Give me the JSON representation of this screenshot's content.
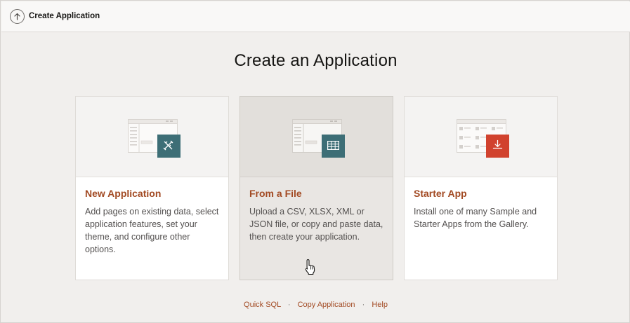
{
  "header": {
    "title": "Create Application",
    "back_icon": "arrow-up-circle-icon"
  },
  "main": {
    "heading": "Create an Application",
    "cards": [
      {
        "title": "New Application",
        "description": "Add pages on existing data, select application features, set your theme, and configure other options.",
        "icon": "pencil-ruler-icon",
        "badge_color": "#3d6e76"
      },
      {
        "title": "From a File",
        "description": "Upload a CSV, XLSX, XML or JSON file, or copy and paste data, then create your application.",
        "icon": "table-grid-icon",
        "badge_color": "#3d6e76"
      },
      {
        "title": "Starter App",
        "description": "Install one of many Sample and Starter Apps from the Gallery.",
        "icon": "download-icon",
        "badge_color": "#d1422e"
      }
    ]
  },
  "footer": {
    "links": [
      "Quick SQL",
      "Copy Application",
      "Help"
    ],
    "separator": "·"
  },
  "colors": {
    "accent": "#a24a23",
    "background": "#f1efed"
  }
}
